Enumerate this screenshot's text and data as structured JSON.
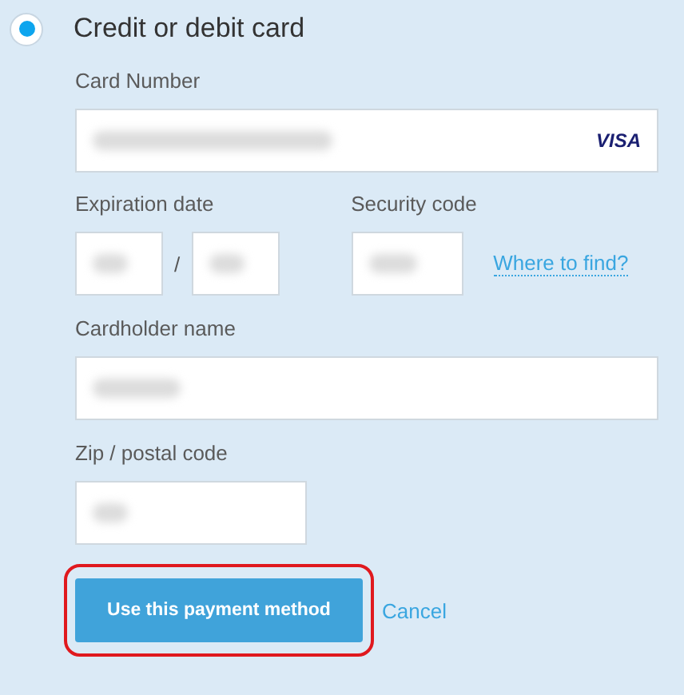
{
  "payment_option": {
    "label": "Credit or debit card",
    "selected": true
  },
  "card_number": {
    "label": "Card Number",
    "blurred": true,
    "brand": "VISA"
  },
  "expiration": {
    "label": "Expiration date",
    "month_blurred": true,
    "separator": "/",
    "year_blurred": true
  },
  "security_code": {
    "label": "Security code",
    "blurred": true,
    "help_link": "Where to find?"
  },
  "cardholder_name": {
    "label": "Cardholder name",
    "blurred": true
  },
  "postal_code": {
    "label": "Zip / postal code",
    "blurred": true
  },
  "buttons": {
    "submit": {
      "label": "Use this payment method",
      "highlighted": true
    },
    "cancel": {
      "label": "Cancel"
    }
  }
}
